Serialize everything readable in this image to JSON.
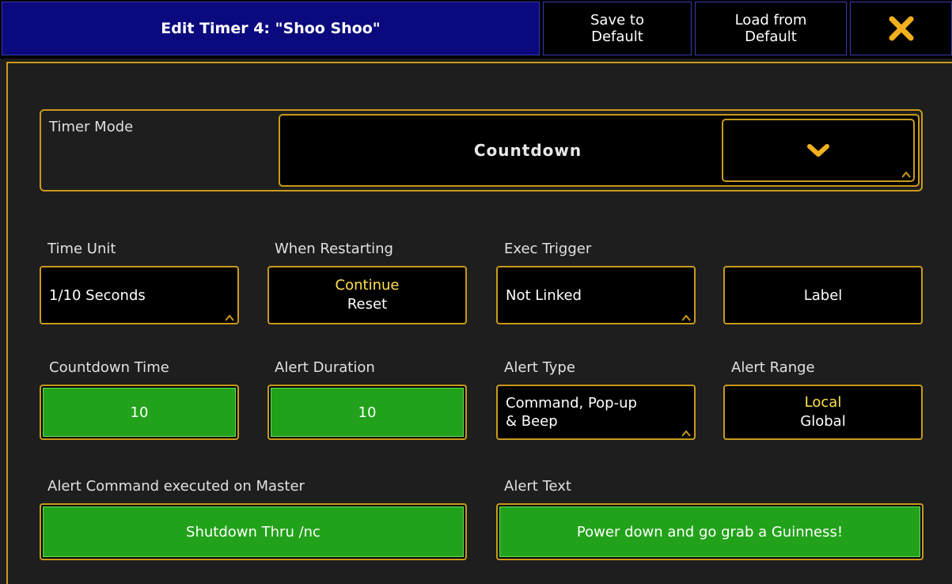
{
  "window": {
    "title": "Edit Timer 4: \"Shoo Shoo\"",
    "save_default": "Save to\nDefault",
    "load_default": "Load from\nDefault",
    "close_glyph": "✕"
  },
  "timer_mode": {
    "label": "Timer Mode",
    "value": "Countdown"
  },
  "time_unit": {
    "label": "Time Unit",
    "value": "1/10 Seconds"
  },
  "when_restarting": {
    "label": "When Restarting",
    "options": [
      "Continue",
      "Reset"
    ],
    "selected": "Continue"
  },
  "exec_trigger": {
    "label": "Exec Trigger",
    "value": "Not Linked"
  },
  "label_button": "Label",
  "countdown_time": {
    "label": "Countdown Time",
    "value": "10"
  },
  "alert_duration": {
    "label": "Alert Duration",
    "value": "10"
  },
  "alert_type": {
    "label": "Alert Type",
    "value_line1": "Command, Pop-up",
    "value_line2": "& Beep"
  },
  "alert_range": {
    "label": "Alert Range",
    "options": [
      "Local",
      "Global"
    ],
    "selected": "Local"
  },
  "alert_command": {
    "label": "Alert Command executed on Master",
    "value": "Shutdown Thru /nc"
  },
  "alert_text": {
    "label": "Alert Text",
    "value": "Power down and go grab a Guinness!"
  },
  "colors": {
    "title_bg": "#0a0a7e",
    "accent": "#c99a1a",
    "selected_text": "#ffe14a",
    "green": "#22a21a"
  }
}
